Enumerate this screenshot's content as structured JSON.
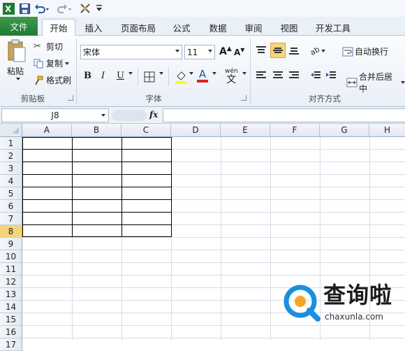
{
  "quick_access": {
    "icons": [
      "excel-logo-icon",
      "save-icon",
      "undo-icon",
      "redo-icon",
      "customize-icon"
    ]
  },
  "tabs": {
    "file": "文件",
    "items": [
      "开始",
      "插入",
      "页面布局",
      "公式",
      "数据",
      "审阅",
      "视图",
      "开发工具"
    ],
    "active": "开始"
  },
  "clipboard": {
    "paste": "粘贴",
    "cut": "剪切",
    "copy": "复制",
    "format_painter": "格式刷",
    "label": "剪贴板"
  },
  "font": {
    "name": "宋体",
    "size": "11",
    "bold": "B",
    "italic": "I",
    "underline": "U",
    "label": "字体",
    "phonetic": "wén 文"
  },
  "alignment": {
    "wrap": "自动换行",
    "merge": "合并后居中",
    "label": "对齐方式"
  },
  "formula_bar": {
    "name_box": "J8",
    "fx": "fx",
    "formula": ""
  },
  "sheet": {
    "columns": [
      "A",
      "B",
      "C",
      "D",
      "E",
      "F",
      "G",
      "H"
    ],
    "rows": [
      "1",
      "2",
      "3",
      "4",
      "5",
      "6",
      "7",
      "8",
      "9",
      "10",
      "11",
      "12",
      "13",
      "14",
      "15",
      "16",
      "17"
    ],
    "selected_row": "8",
    "bordered_range": "A1:C8"
  },
  "watermark": {
    "brand": "查询啦",
    "url": "chaxunla.com"
  },
  "colors": {
    "file_tab": "#2a8a3c",
    "selected_row": "#f5d47a",
    "watermark_blue": "#1a8fe0"
  }
}
